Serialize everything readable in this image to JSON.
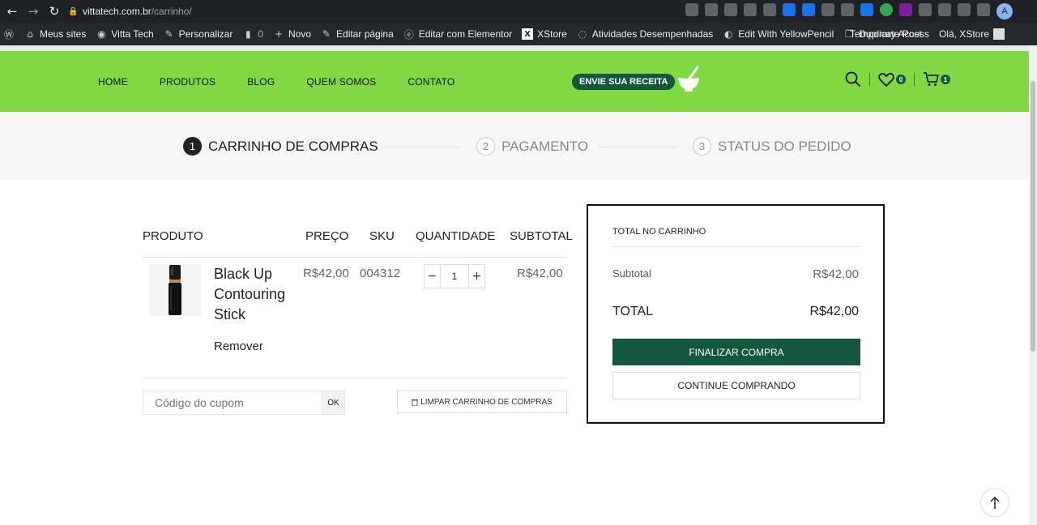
{
  "browser": {
    "url_domain": "vittatech.com.br",
    "url_path": "/carrinho/",
    "profile_initial": "A"
  },
  "admin_bar": {
    "items": [
      {
        "label": "Meus sites",
        "icon": "house-icon"
      },
      {
        "label": "Vitta Tech",
        "icon": "palette-icon"
      },
      {
        "label": "Personalizar",
        "icon": "brush-icon"
      },
      {
        "label": "0",
        "icon": "comment-icon"
      },
      {
        "label": "Novo",
        "icon": "plus-icon"
      },
      {
        "label": "Editar página",
        "icon": "pencil-icon"
      },
      {
        "label": "Editar com Elementor",
        "icon": "elementor-icon"
      },
      {
        "label": "XStore",
        "icon": "xstore-icon"
      },
      {
        "label": "Atividades Desempenhadas",
        "icon": "chat-icon"
      },
      {
        "label": "Edit With YellowPencil",
        "icon": "yellowpencil-icon"
      },
      {
        "label": "Duplicate Post",
        "icon": "copy-icon"
      }
    ],
    "temporary_access": "Temporary Access",
    "greeting": "Olá, XStore"
  },
  "header": {
    "nav": [
      "HOME",
      "PRODUTOS",
      "BLOG",
      "QUEM SOMOS",
      "CONTATO"
    ],
    "recipe_button": "ENVIE SUA RECEITA",
    "wishlist_count": "0",
    "cart_count": "1",
    "accent_color": "#80d842",
    "brand_dark": "#13573c"
  },
  "steps": [
    {
      "num": "1",
      "label": "CARRINHO DE COMPRAS",
      "active": true
    },
    {
      "num": "2",
      "label": "PAGAMENTO",
      "active": false
    },
    {
      "num": "3",
      "label": "STATUS DO PEDIDO",
      "active": false
    }
  ],
  "cart": {
    "columns": [
      "PRODUTO",
      "PREÇO",
      "SKU",
      "QUANTIDADE",
      "SUBTOTAL"
    ],
    "items": [
      {
        "name": "Black Up Contouring Stick",
        "price": "R$42,00",
        "sku": "004312",
        "quantity": "1",
        "subtotal": "R$42,00",
        "remove_label": "Remover"
      }
    ],
    "coupon_placeholder": "Código do cupom",
    "coupon_ok": "OK",
    "clear_cart": "LIMPAR CARRINHO DE COMPRAS"
  },
  "totals": {
    "title": "TOTAL NO CARRINHO",
    "subtotal_label": "Subtotal",
    "subtotal_value": "R$42,00",
    "total_label": "TOTAL",
    "total_value": "R$42,00",
    "checkout_label": "FINALIZAR COMPRA",
    "continue_label": "CONTINUE COMPRANDO"
  }
}
